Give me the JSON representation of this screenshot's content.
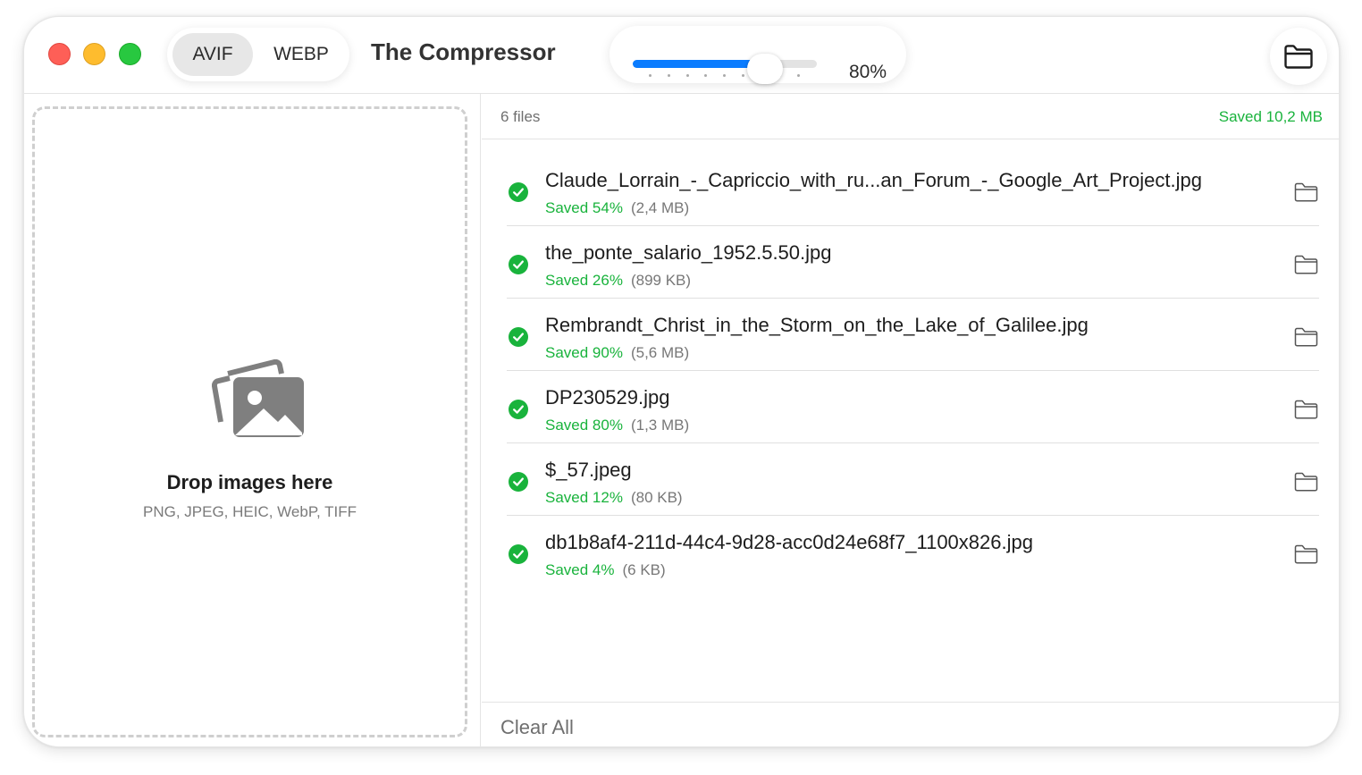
{
  "window": {
    "traffic_lights": [
      "close",
      "minimize",
      "zoom"
    ]
  },
  "toolbar": {
    "formats": [
      {
        "label": "AVIF",
        "selected": true
      },
      {
        "label": "WEBP",
        "selected": false
      }
    ],
    "title": "The Compressor",
    "quality": {
      "value_label": "80%",
      "fraction": 0.72,
      "tick_count": 9
    },
    "open_folder_icon": "folder-icon"
  },
  "drop_zone": {
    "icon": "photos-icon",
    "title": "Drop images here",
    "formats": "PNG, JPEG, HEIC, WebP, TIFF"
  },
  "file_list": {
    "count_label": "6 files",
    "total_saved": "Saved 10,2 MB",
    "items": [
      {
        "name": "Claude_Lorrain_-_Capriccio_with_ru...an_Forum_-_Google_Art_Project.jpg",
        "saved": "Saved 54%",
        "size": "(2,4 MB)"
      },
      {
        "name": "the_ponte_salario_1952.5.50.jpg",
        "saved": "Saved 26%",
        "size": "(899 KB)"
      },
      {
        "name": "Rembrandt_Christ_in_the_Storm_on_the_Lake_of_Galilee.jpg",
        "saved": "Saved 90%",
        "size": "(5,6 MB)"
      },
      {
        "name": "DP230529.jpg",
        "saved": "Saved 80%",
        "size": "(1,3 MB)"
      },
      {
        "name": "$_57.jpeg",
        "saved": "Saved 12%",
        "size": "(80 KB)"
      },
      {
        "name": "db1b8af4-211d-44c4-9d28-acc0d24e68f7_1100x826.jpg",
        "saved": "Saved 4%",
        "size": "(6 KB)"
      }
    ],
    "clear_all": "Clear All"
  },
  "colors": {
    "accent": "#0a7cff",
    "success": "#19b33c",
    "close": "#fe5f57",
    "minimize": "#febc2e",
    "zoom": "#28c840"
  }
}
